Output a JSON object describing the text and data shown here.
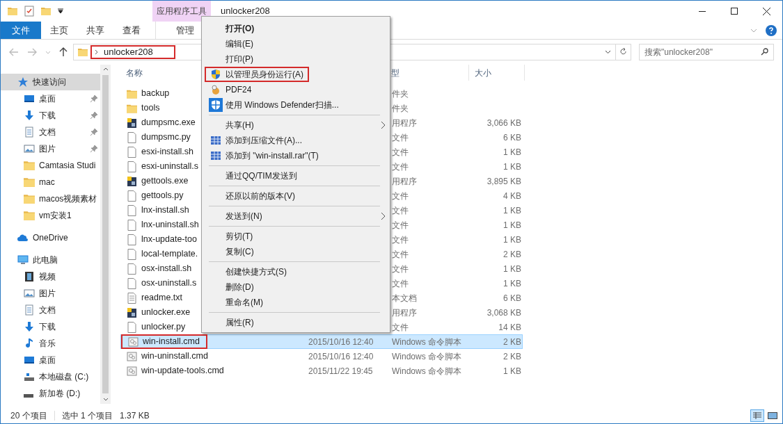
{
  "window": {
    "title": "unlocker208",
    "context_tab_group": "应用程序工具"
  },
  "ribbon_tabs": [
    {
      "label": "文件",
      "kind": "file"
    },
    {
      "label": "主页",
      "kind": "tab"
    },
    {
      "label": "共享",
      "kind": "tab"
    },
    {
      "label": "查看",
      "kind": "tab"
    },
    {
      "label": "管理",
      "kind": "context"
    }
  ],
  "address": {
    "path": "unlocker208",
    "outlined": true
  },
  "search": {
    "placeholder": "搜索\"unlocker208\""
  },
  "nav": [
    {
      "label": "快速访问",
      "kind": "star",
      "selected": true,
      "children": [
        {
          "label": "桌面",
          "kind": "desktop",
          "pinned": true
        },
        {
          "label": "下载",
          "kind": "download",
          "pinned": true
        },
        {
          "label": "文档",
          "kind": "docs",
          "pinned": true
        },
        {
          "label": "图片",
          "kind": "pictures",
          "pinned": true
        },
        {
          "label": "Camtasia Studi",
          "kind": "folder",
          "pinned": false
        },
        {
          "label": "mac",
          "kind": "folder",
          "pinned": false
        },
        {
          "label": "macos视频素材",
          "kind": "folder",
          "pinned": false
        },
        {
          "label": "vm安装1",
          "kind": "folder",
          "pinned": false
        }
      ]
    },
    {
      "label": "OneDrive",
      "kind": "cloud",
      "selected": false
    },
    {
      "label": "此电脑",
      "kind": "pc",
      "selected": false,
      "children": [
        {
          "label": "视频",
          "kind": "video",
          "pinned": false
        },
        {
          "label": "图片",
          "kind": "pictures",
          "pinned": false
        },
        {
          "label": "文档",
          "kind": "docs",
          "pinned": false
        },
        {
          "label": "下载",
          "kind": "download",
          "pinned": false
        },
        {
          "label": "音乐",
          "kind": "music",
          "pinned": false
        },
        {
          "label": "桌面",
          "kind": "desktop",
          "pinned": false
        },
        {
          "label": "本地磁盘 (C:)",
          "kind": "drive-c",
          "pinned": false
        },
        {
          "label": "新加卷 (D:)",
          "kind": "drive",
          "pinned": false
        }
      ]
    }
  ],
  "table": {
    "columns": [
      "名称",
      "型",
      "大小"
    ],
    "rows": [
      {
        "name": "backup",
        "kind": "folder",
        "type": "件夹",
        "selected": false,
        "outlined": false
      },
      {
        "name": "tools",
        "kind": "folder",
        "type": "件夹",
        "selected": false,
        "outlined": false
      },
      {
        "name": "dumpsmc.exe",
        "kind": "exe",
        "type": "用程序",
        "size": "3,066 KB",
        "selected": false,
        "outlined": false
      },
      {
        "name": "dumpsmc.py",
        "kind": "file",
        "type": "文件",
        "size": "6 KB",
        "selected": false,
        "outlined": false
      },
      {
        "name": "esxi-install.sh",
        "kind": "file",
        "type": "文件",
        "size": "1 KB",
        "selected": false,
        "outlined": false
      },
      {
        "name": "esxi-uninstall.s",
        "kind": "file",
        "type": "文件",
        "size": "1 KB",
        "selected": false,
        "outlined": false
      },
      {
        "name": "gettools.exe",
        "kind": "exe",
        "type": "用程序",
        "size": "3,895 KB",
        "selected": false,
        "outlined": false
      },
      {
        "name": "gettools.py",
        "kind": "file",
        "type": "文件",
        "size": "4 KB",
        "selected": false,
        "outlined": false
      },
      {
        "name": "lnx-install.sh",
        "kind": "file",
        "type": "文件",
        "size": "1 KB",
        "selected": false,
        "outlined": false
      },
      {
        "name": "lnx-uninstall.sh",
        "kind": "file",
        "type": "文件",
        "size": "1 KB",
        "selected": false,
        "outlined": false
      },
      {
        "name": "lnx-update-too",
        "kind": "file",
        "type": "文件",
        "size": "1 KB",
        "selected": false,
        "outlined": false
      },
      {
        "name": "local-template.",
        "kind": "file",
        "type": "文件",
        "size": "2 KB",
        "selected": false,
        "outlined": false
      },
      {
        "name": "osx-install.sh",
        "kind": "file",
        "type": "文件",
        "size": "1 KB",
        "selected": false,
        "outlined": false
      },
      {
        "name": "osx-uninstall.s",
        "kind": "file",
        "type": "文件",
        "size": "1 KB",
        "selected": false,
        "outlined": false
      },
      {
        "name": "readme.txt",
        "kind": "text",
        "type": "本文档",
        "size": "6 KB",
        "selected": false,
        "outlined": false
      },
      {
        "name": "unlocker.exe",
        "kind": "exe",
        "type": "用程序",
        "size": "3,068 KB",
        "selected": false,
        "outlined": false
      },
      {
        "name": "unlocker.py",
        "kind": "file",
        "type": "文件",
        "size": "14 KB",
        "selected": false,
        "outlined": false
      },
      {
        "name": "win-install.cmd",
        "kind": "cmd",
        "date": "2015/10/16 12:40",
        "type": "Windows 命令脚本",
        "size": "2 KB",
        "selected": true,
        "outlined": true
      },
      {
        "name": "win-uninstall.cmd",
        "kind": "cmd",
        "date": "2015/10/16 12:40",
        "type": "Windows 命令脚本",
        "size": "2 KB",
        "selected": false,
        "outlined": false
      },
      {
        "name": "win-update-tools.cmd",
        "kind": "cmd",
        "date": "2015/11/22 19:45",
        "type": "Windows 命令脚本",
        "size": "1 KB",
        "selected": false,
        "outlined": false
      }
    ]
  },
  "context_menu": [
    {
      "kind": "item",
      "label": "打开(O)",
      "default": true,
      "outlined": false,
      "submenu": false
    },
    {
      "kind": "item",
      "label": "编辑(E)",
      "default": false,
      "outlined": false,
      "submenu": false
    },
    {
      "kind": "item",
      "label": "打印(P)",
      "default": false,
      "outlined": false,
      "submenu": false
    },
    {
      "kind": "shield",
      "label": "以管理员身份运行(A)",
      "default": false,
      "outlined": true,
      "submenu": false
    },
    {
      "kind": "mascot",
      "label": "PDF24",
      "default": false,
      "outlined": false,
      "submenu": false
    },
    {
      "kind": "defender",
      "label": "使用 Windows Defender扫描...",
      "default": false,
      "outlined": false,
      "submenu": false
    },
    {
      "kind": "separator"
    },
    {
      "kind": "item",
      "label": "共享(H)",
      "default": false,
      "outlined": false,
      "submenu": true
    },
    {
      "kind": "archive",
      "label": "添加到压缩文件(A)...",
      "default": false,
      "outlined": false,
      "submenu": false
    },
    {
      "kind": "archive",
      "label": "添加到 \"win-install.rar\"(T)",
      "default": false,
      "outlined": false,
      "submenu": false
    },
    {
      "kind": "separator"
    },
    {
      "kind": "item",
      "label": "通过QQ/TIM发送到",
      "default": false,
      "outlined": false,
      "submenu": false
    },
    {
      "kind": "separator"
    },
    {
      "kind": "item",
      "label": "还原以前的版本(V)",
      "default": false,
      "outlined": false,
      "submenu": false
    },
    {
      "kind": "separator"
    },
    {
      "kind": "item",
      "label": "发送到(N)",
      "default": false,
      "outlined": false,
      "submenu": true
    },
    {
      "kind": "separator"
    },
    {
      "kind": "item",
      "label": "剪切(T)",
      "default": false,
      "outlined": false,
      "submenu": false
    },
    {
      "kind": "item",
      "label": "复制(C)",
      "default": false,
      "outlined": false,
      "submenu": false
    },
    {
      "kind": "separator"
    },
    {
      "kind": "item",
      "label": "创建快捷方式(S)",
      "default": false,
      "outlined": false,
      "submenu": false
    },
    {
      "kind": "item",
      "label": "删除(D)",
      "default": false,
      "outlined": false,
      "submenu": false
    },
    {
      "kind": "item",
      "label": "重命名(M)",
      "default": false,
      "outlined": false,
      "submenu": false
    },
    {
      "kind": "separator"
    },
    {
      "kind": "item",
      "label": "属性(R)",
      "default": false,
      "outlined": false,
      "submenu": false
    }
  ],
  "status_bar": {
    "count": "20 个项目",
    "selection": "选中 1 个项目",
    "size": "1.37 KB"
  }
}
